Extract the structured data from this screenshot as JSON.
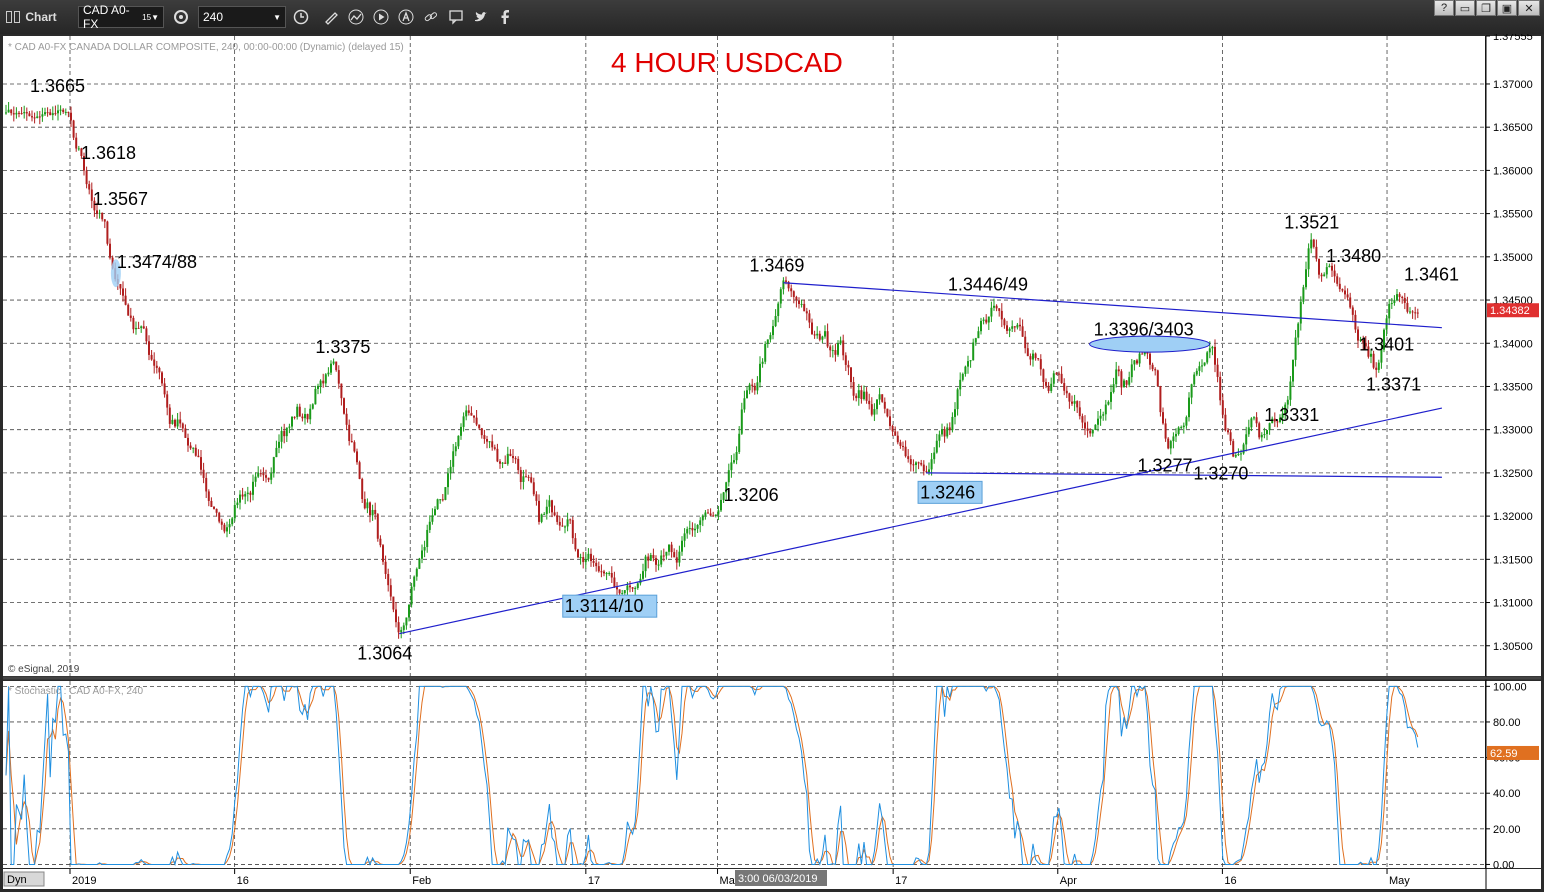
{
  "toolbar": {
    "title": "Chart",
    "symbol": "CAD A0-FX",
    "symbol_sup": "15",
    "interval": "240",
    "icons": [
      "layout-icon",
      "settings-gear-icon",
      "clock-icon",
      "pencil-icon",
      "line-icon",
      "play-icon",
      "alert-icon",
      "link-icon",
      "chat-icon",
      "twitter-icon",
      "facebook-icon"
    ],
    "window_buttons": [
      "?",
      "▭",
      "❐",
      "▣",
      "✕"
    ]
  },
  "chart_header": "* CAD A0-FX  CANADA DOLLAR COMPOSITE, 240, 00:00-00:00 (Dynamic) (delayed 15)",
  "chart_title": "4 HOUR USDCAD",
  "copyright": "© eSignal, 2019",
  "stoch_header": "* Stochastic : CAD A0-FX, 240",
  "dyn_label": "Dyn",
  "crosshair_label": "3:00 06/03/2019",
  "last_price_label": "1.34382",
  "stoch_last_label": "62.59",
  "colors": {
    "up_candle": "#1a9a1a",
    "down_candle": "#b01e1e",
    "trendline": "#1f1fcc",
    "title": "#e00000",
    "price_tag": "#e03030",
    "stoch_k": "#1f8fe0",
    "stoch_d": "#e07020",
    "highlight": "#9fcff5"
  },
  "chart_data": {
    "type": "candlestick",
    "title": "4 HOUR USDCAD",
    "price_axis": {
      "ticks": [
        "1.37555",
        "1.37000",
        "1.36500",
        "1.36000",
        "1.35500",
        "1.35000",
        "1.34500",
        "1.34000",
        "1.33500",
        "1.33000",
        "1.32500",
        "1.32000",
        "1.31500",
        "1.31000",
        "1.30500"
      ],
      "ylim": [
        1.3015,
        1.37555
      ]
    },
    "time_axis": {
      "ticks": [
        "2019",
        "16",
        "Feb",
        "17",
        "Mar",
        "17",
        "Apr",
        "16",
        "May"
      ]
    },
    "key_points": [
      {
        "t": "2019-01-01",
        "price": 1.3665,
        "label": "1.3665"
      },
      {
        "t": "2019-01-02",
        "price": 1.3618,
        "label": "1.3618"
      },
      {
        "t": "2019-01-03",
        "price": 1.3567,
        "label": "1.3567"
      },
      {
        "t": "2019-01-05",
        "price": 1.3481,
        "label": "1.3474/88"
      },
      {
        "t": "2019-01-15",
        "price": 1.3185,
        "label": ""
      },
      {
        "t": "2019-01-25",
        "price": 1.3375,
        "label": "1.3375"
      },
      {
        "t": "2019-01-31",
        "price": 1.3064,
        "label": "1.3064"
      },
      {
        "t": "2019-02-06",
        "price": 1.332,
        "label": ""
      },
      {
        "t": "2019-02-20",
        "price": 1.3112,
        "label": "1.3114/10"
      },
      {
        "t": "2019-03-01",
        "price": 1.3206,
        "label": "1.3206"
      },
      {
        "t": "2019-03-07",
        "price": 1.3469,
        "label": "1.3469"
      },
      {
        "t": "2019-03-20",
        "price": 1.3246,
        "label": "1.3246"
      },
      {
        "t": "2019-03-26",
        "price": 1.3447,
        "label": "1.3446/49"
      },
      {
        "t": "2019-04-04",
        "price": 1.33,
        "label": ""
      },
      {
        "t": "2019-04-09",
        "price": 1.34,
        "label": "1.3396/3403"
      },
      {
        "t": "2019-04-11",
        "price": 1.3277,
        "label": "1.3277"
      },
      {
        "t": "2019-04-15",
        "price": 1.3395,
        "label": ""
      },
      {
        "t": "2019-04-17",
        "price": 1.327,
        "label": "1.3270"
      },
      {
        "t": "2019-04-22",
        "price": 1.3331,
        "label": "1.3331"
      },
      {
        "t": "2019-04-24",
        "price": 1.3521,
        "label": "1.3521"
      },
      {
        "t": "2019-04-26",
        "price": 1.348,
        "label": "1.3480"
      },
      {
        "t": "2019-04-29",
        "price": 1.3401,
        "label": "1.3401"
      },
      {
        "t": "2019-04-30",
        "price": 1.3371,
        "label": "1.3371"
      },
      {
        "t": "2019-05-02",
        "price": 1.3461,
        "label": "1.3461"
      },
      {
        "t": "2019-05-03",
        "price": 1.3438,
        "label": ""
      }
    ],
    "trendlines": [
      {
        "from": {
          "t": "2019-01-31",
          "price": 1.3064
        },
        "to": {
          "t": "2019-05-06",
          "price": 1.3325
        }
      },
      {
        "from": {
          "t": "2019-03-20",
          "price": 1.325
        },
        "to": {
          "t": "2019-05-06",
          "price": 1.3245
        }
      },
      {
        "from": {
          "t": "2019-03-07",
          "price": 1.347
        },
        "to": {
          "t": "2019-05-06",
          "price": 1.3418
        }
      }
    ],
    "stochastic": {
      "axis_ticks": [
        "100.00",
        "80.00",
        "60.00",
        "40.00",
        "20.00",
        "0.00"
      ],
      "ylim": [
        -2,
        103
      ],
      "last_value": 62.59
    }
  }
}
